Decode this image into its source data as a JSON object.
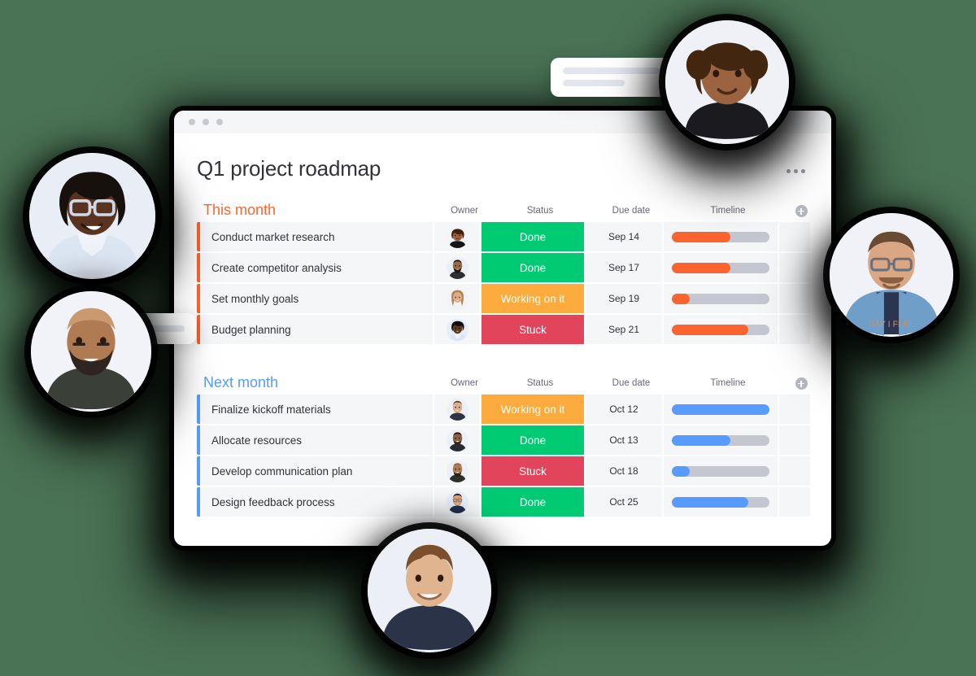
{
  "page": {
    "background_color": "#4a7254"
  },
  "window": {
    "titlebar_dots": 3,
    "board_title": "Q1 project roadmap",
    "menu_icon": "kebab-menu-icon"
  },
  "columns": {
    "owner": "Owner",
    "status": "Status",
    "due_date": "Due date",
    "timeline": "Timeline",
    "add_column": "+"
  },
  "colors": {
    "accent_orange": "#fb642e",
    "accent_blue": "#579bfc",
    "status_done": "#00ca72",
    "status_working": "#fdab3d",
    "status_stuck": "#e2445c",
    "track_gray": "#c4c7d0",
    "row_bg": "#f5f6f8"
  },
  "groups": [
    {
      "name": "This month",
      "color": "#ff642e",
      "accent": "orange",
      "rows": [
        {
          "task": "Conduct market research",
          "owner": "avatar-woman-curly-hair",
          "status": "Done",
          "status_color": "#00ca72",
          "due_date": "Sep 14",
          "timeline_percent": 60,
          "timeline_color": "#fb642e"
        },
        {
          "task": "Create competitor analysis",
          "owner": "avatar-man-beard",
          "status": "Done",
          "status_color": "#00ca72",
          "due_date": "Sep 17",
          "timeline_percent": 60,
          "timeline_color": "#fb642e"
        },
        {
          "task": "Set monthly goals",
          "owner": "avatar-woman-long-hair",
          "status": "Working on it",
          "status_color": "#fdab3d",
          "due_date": "Sep 19",
          "timeline_percent": 18,
          "timeline_color": "#fb642e"
        },
        {
          "task": "Budget planning",
          "owner": "avatar-woman-dark-hair",
          "status": "Stuck",
          "status_color": "#e2445c",
          "due_date": "Sep 21",
          "timeline_percent": 78,
          "timeline_color": "#fb642e"
        }
      ]
    },
    {
      "name": "Next month",
      "color": "#579bfc",
      "accent": "blue",
      "rows": [
        {
          "task": "Finalize kickoff materials",
          "owner": "avatar-man-short-hair",
          "status": "Working on it",
          "status_color": "#fdab3d",
          "due_date": "Oct 12",
          "timeline_percent": 100,
          "timeline_color": "#579bfc"
        },
        {
          "task": "Allocate resources",
          "owner": "avatar-man-smiling",
          "status": "Done",
          "status_color": "#00ca72",
          "due_date": "Oct 13",
          "timeline_percent": 60,
          "timeline_color": "#579bfc"
        },
        {
          "task": "Develop communication plan",
          "owner": "avatar-man-bald-beard",
          "status": "Stuck",
          "status_color": "#e2445c",
          "due_date": "Oct 18",
          "timeline_percent": 18,
          "timeline_color": "#579bfc"
        },
        {
          "task": "Design feedback process",
          "owner": "avatar-man-glasses",
          "status": "Done",
          "status_color": "#00ca72",
          "due_date": "Oct 25",
          "timeline_percent": 78,
          "timeline_color": "#579bfc"
        }
      ]
    }
  ],
  "floating_avatars": [
    {
      "id": "avatar-top",
      "name": "avatar-woman-curly-hair-large"
    },
    {
      "id": "avatar-left-top",
      "name": "avatar-woman-glasses-large"
    },
    {
      "id": "avatar-left-bot",
      "name": "avatar-man-beard-large"
    },
    {
      "id": "avatar-right",
      "name": "avatar-man-glasses-denim-large"
    },
    {
      "id": "avatar-bottom",
      "name": "avatar-man-curly-hair-large"
    }
  ],
  "speech_bubbles": [
    {
      "id": "bubble-top",
      "lines": 2,
      "direction": "right"
    },
    {
      "id": "bubble-left",
      "lines": 1,
      "direction": "left"
    }
  ]
}
